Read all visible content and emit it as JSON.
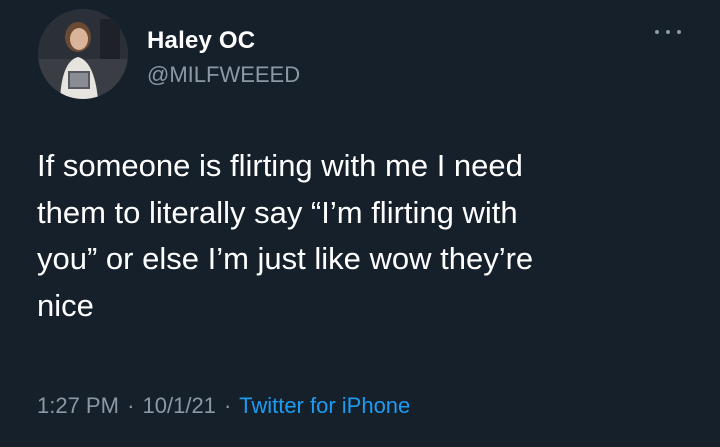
{
  "tweet": {
    "author": {
      "name": "Haley OC",
      "handle": "@MILFWEEED"
    },
    "text_lines": [
      "If someone is flirting with me I need",
      "them to literally say “I’m flirting with",
      "you” or else I’m just like wow they’re",
      "nice"
    ],
    "time": "1:27 PM",
    "date": "10/1/21",
    "separator": "·",
    "source": "Twitter for iPhone"
  },
  "icons": {
    "more": "more-options-icon"
  },
  "colors": {
    "background": "#15202b",
    "primary_text": "#ffffff",
    "secondary_text": "#8b98a5",
    "accent": "#1d9bf0"
  }
}
